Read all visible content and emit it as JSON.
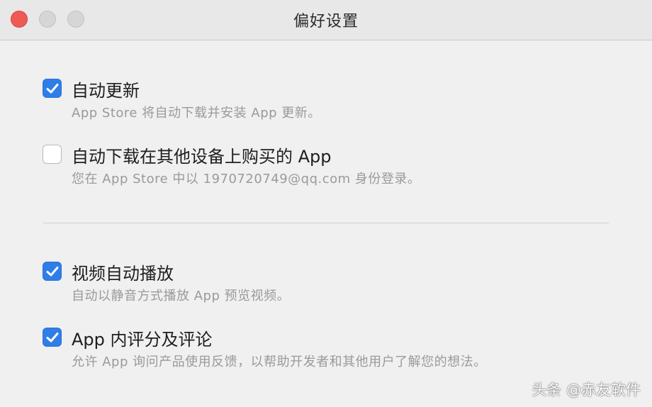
{
  "window": {
    "title": "偏好设置",
    "colors": {
      "close": "#ee5b55",
      "inactive_button": "#d6d6d6",
      "checkbox_checked": "#2f7ee8",
      "description_text": "#9a9a9a"
    }
  },
  "options": [
    {
      "label": "自动更新",
      "description": "App Store 将自动下载并安装 App 更新。",
      "checked": true
    },
    {
      "label": "自动下载在其他设备上购买的 App",
      "description": "您在 App Store 中以 1970720749@qq.com 身份登录。",
      "checked": false
    },
    {
      "label": "视频自动播放",
      "description": "自动以静音方式播放 App 预览视频。",
      "checked": true
    },
    {
      "label": "App 内评分及评论",
      "description": "允许 App 询问产品使用反馈，以帮助开发者和其他用户了解您的想法。",
      "checked": true
    }
  ],
  "watermark": "头条 @赤友软件"
}
